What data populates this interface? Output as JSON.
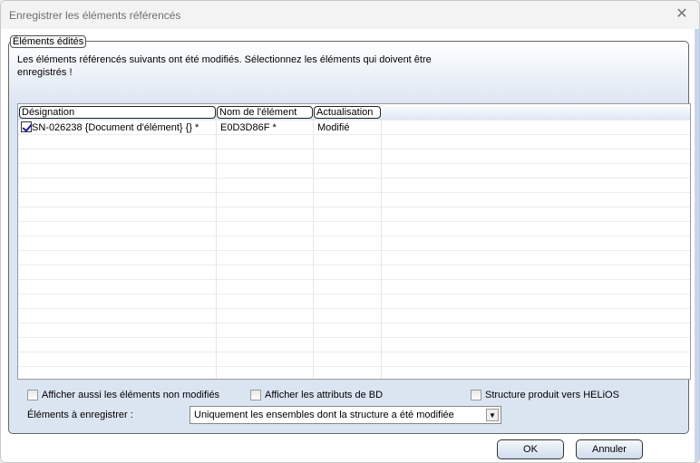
{
  "window": {
    "title": "Enregistrer les éléments référencés",
    "close_icon": "close-icon"
  },
  "group": {
    "legend": "Éléments édités",
    "intro": "Les éléments référencés suivants ont été modifiés. Sélectionnez les éléments qui doivent être enregistrés !"
  },
  "list": {
    "columns": [
      "Désignation",
      "Nom de l'élément",
      "Actualisation"
    ],
    "rows": [
      {
        "checked": true,
        "designation": "SN-026238 {Document d'élément} {} *",
        "name": "E0D3D86F *",
        "status": "Modifié"
      }
    ]
  },
  "options": {
    "show_unmodified": "Afficher aussi les éléments non modifiés",
    "show_db_attrs": "Afficher les attributs de BD",
    "helios": "Structure produit vers HELiOS"
  },
  "save_select": {
    "label": "Éléments à enregistrer :",
    "value": "Uniquement les ensembles dont la structure a été modifiée"
  },
  "buttons": {
    "ok": "OK",
    "cancel": "Annuler"
  }
}
